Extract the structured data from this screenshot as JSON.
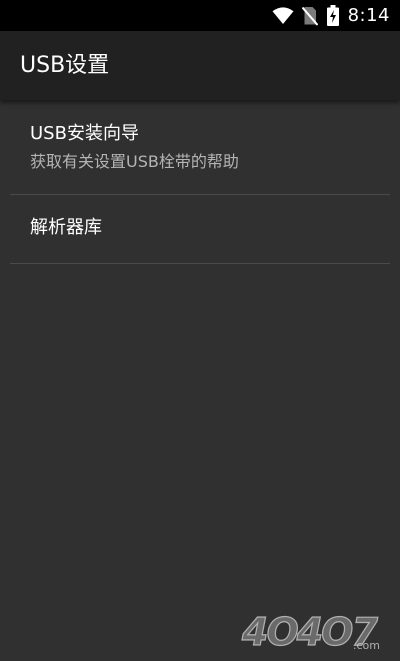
{
  "status_bar": {
    "time": "8:14",
    "icons": [
      "wifi-icon",
      "no-sim-icon",
      "battery-charging-icon"
    ]
  },
  "toolbar": {
    "title": "USB设置"
  },
  "preferences": [
    {
      "title": "USB安装向导",
      "summary": "获取有关设置USB栓带的帮助"
    },
    {
      "title": "解析器库"
    }
  ],
  "watermark": {
    "text": "4O4O7",
    "suffix": ".com"
  },
  "colors": {
    "background": "#303030",
    "toolbar": "#212121",
    "status_bar": "#000000",
    "divider": "#4a4a4a",
    "primary_text": "#ffffff",
    "secondary_text": "#b4b4b4"
  }
}
